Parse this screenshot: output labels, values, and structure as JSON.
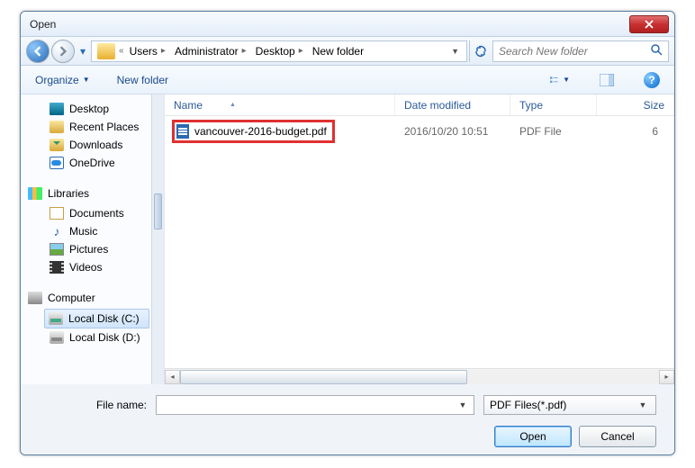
{
  "window": {
    "title": "Open"
  },
  "nav": {
    "crumbs": [
      "Users",
      "Administrator",
      "Desktop",
      "New folder"
    ],
    "search_placeholder": "Search New folder"
  },
  "toolbar": {
    "organize": "Organize",
    "newfolder": "New folder"
  },
  "sidebar": {
    "desktop": "Desktop",
    "recent": "Recent Places",
    "downloads": "Downloads",
    "onedrive": "OneDrive",
    "libraries": "Libraries",
    "documents": "Documents",
    "music": "Music",
    "pictures": "Pictures",
    "videos": "Videos",
    "computer": "Computer",
    "diskc": "Local Disk (C:)",
    "diskd": "Local Disk (D:)"
  },
  "columns": {
    "name": "Name",
    "date": "Date modified",
    "type": "Type",
    "size": "Size"
  },
  "files": [
    {
      "name": "vancouver-2016-budget.pdf",
      "date": "2016/10/20 10:51",
      "type": "PDF File",
      "size": "6"
    }
  ],
  "footer": {
    "filename_label": "File name:",
    "filename_value": "",
    "filter": "PDF Files(*.pdf)",
    "open": "Open",
    "cancel": "Cancel"
  }
}
